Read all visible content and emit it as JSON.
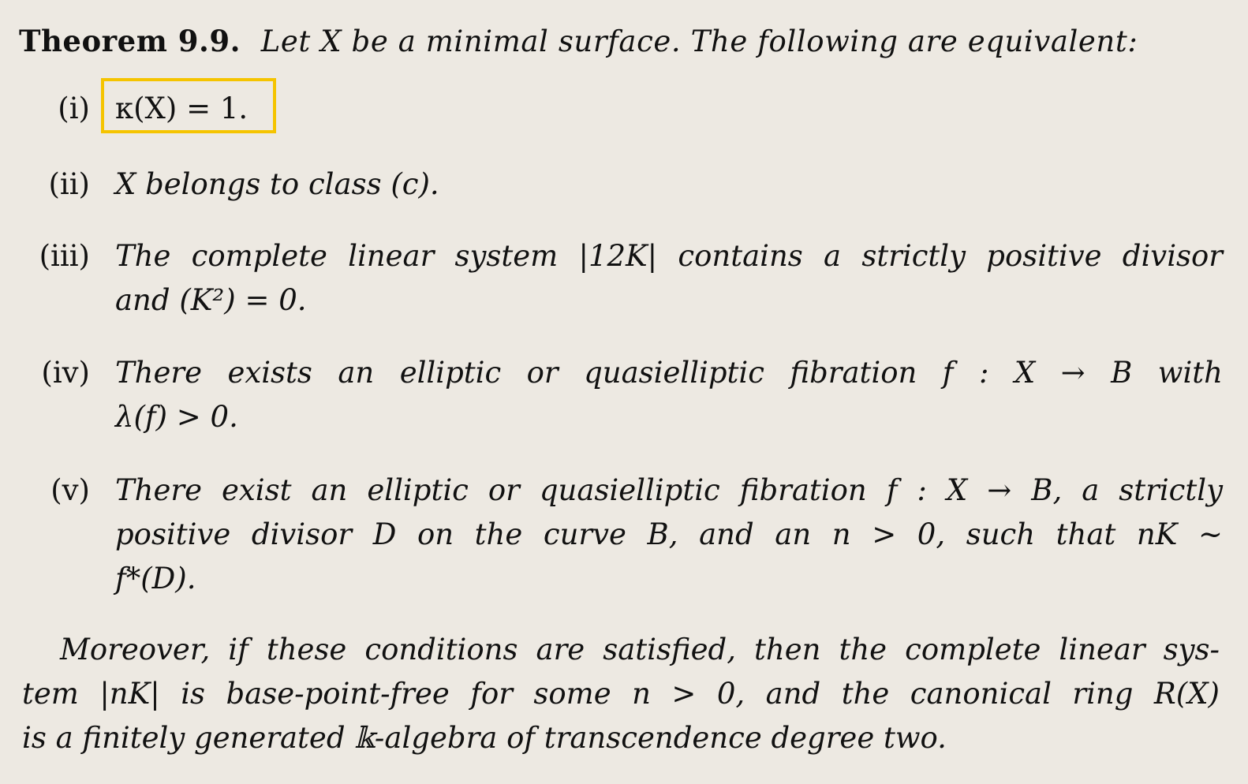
{
  "theorem": {
    "label": "Theorem 9.9.",
    "intro": "Let X be a minimal surface. The following are equivalent:"
  },
  "items": [
    {
      "num": "(i)",
      "lines": [
        "κ(X) = 1."
      ]
    },
    {
      "num": "(ii)",
      "lines": [
        "X belongs to class (c)."
      ]
    },
    {
      "num": "(iii)",
      "lines": [
        "The complete linear system |12K| contains a strictly positive divisor",
        "and (K²) = 0."
      ]
    },
    {
      "num": "(iv)",
      "lines": [
        "There exists an elliptic or quasielliptic fibration f : X → B with",
        "λ(f) > 0."
      ]
    },
    {
      "num": "(v)",
      "lines": [
        "There exist an elliptic or quasielliptic fibration f : X → B, a strictly",
        "positive divisor D on the curve B, and an n > 0, such that nK ~",
        "f*(D)."
      ]
    }
  ],
  "moreover": {
    "lines": [
      "Moreover, if these conditions are satisfied, then the complete linear sys-",
      "tem |nK| is base-point-free for some n > 0, and the canonical ring R(X)",
      "is a finitely generated 𝕜-algebra of transcendence degree two."
    ]
  },
  "colors": {
    "background": "#ede9e2",
    "highlight_border": "#f5c400",
    "text": "#111111"
  }
}
